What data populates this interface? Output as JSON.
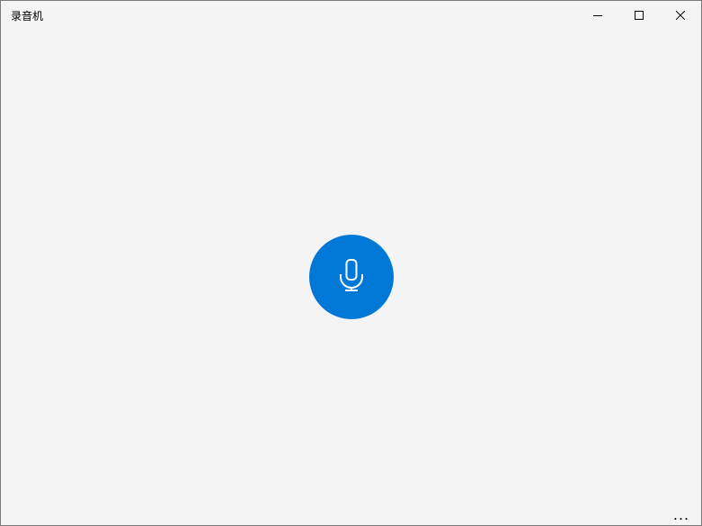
{
  "app": {
    "title": "录音机"
  },
  "window_controls": {
    "minimize_icon": "minimize-icon",
    "maximize_icon": "maximize-icon",
    "close_icon": "close-icon"
  },
  "main": {
    "record_icon": "microphone-icon"
  },
  "footer": {
    "more_label": "..."
  },
  "colors": {
    "accent": "#0078d7",
    "background": "#f4f4f4",
    "border": "#7a7a7a"
  }
}
